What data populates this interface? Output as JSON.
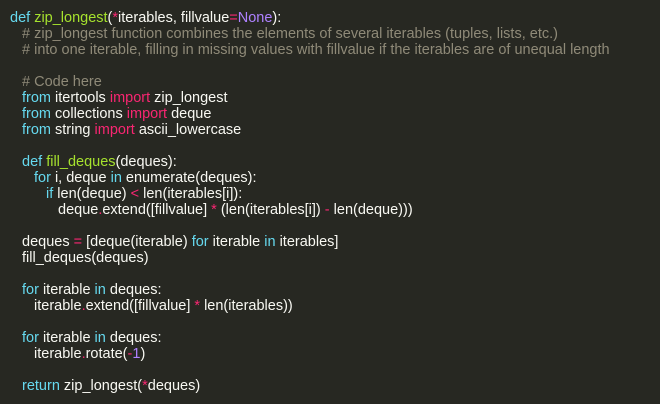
{
  "theme": {
    "background": "#272822",
    "text": "#f8f8f2",
    "keyword": "#66d9ef",
    "import_keyword": "#f92672",
    "operator": "#f92672",
    "function": "#a6e22e",
    "constant": "#ae81ff",
    "comment": "#8f8a78"
  },
  "code": {
    "lines": [
      {
        "tokens": [
          {
            "type": "keyword",
            "text": "def "
          },
          {
            "type": "function",
            "text": "zip_longest"
          },
          {
            "type": "text",
            "text": "("
          },
          {
            "type": "operator",
            "text": "*"
          },
          {
            "type": "text",
            "text": "iterables, fillvalue"
          },
          {
            "type": "operator",
            "text": "="
          },
          {
            "type": "constant",
            "text": "None"
          },
          {
            "type": "text",
            "text": "):"
          }
        ]
      },
      {
        "tokens": [
          {
            "type": "comment",
            "text": "# zip_longest function combines the elements of several iterables (tuples, lists, etc.)"
          }
        ]
      },
      {
        "tokens": [
          {
            "type": "comment",
            "text": "# into one iterable, filling in missing values with fillvalue if the iterables are of unequal length"
          }
        ]
      },
      {
        "tokens": []
      },
      {
        "tokens": [
          {
            "type": "comment",
            "text": "# Code here"
          }
        ]
      },
      {
        "tokens": [
          {
            "type": "keyword",
            "text": "from "
          },
          {
            "type": "text",
            "text": "itertools "
          },
          {
            "type": "import",
            "text": "import "
          },
          {
            "type": "text",
            "text": "zip_longest"
          }
        ]
      },
      {
        "tokens": [
          {
            "type": "keyword",
            "text": "from "
          },
          {
            "type": "text",
            "text": "collections "
          },
          {
            "type": "import",
            "text": "import "
          },
          {
            "type": "text",
            "text": "deque"
          }
        ]
      },
      {
        "tokens": [
          {
            "type": "keyword",
            "text": "from "
          },
          {
            "type": "text",
            "text": "string "
          },
          {
            "type": "import",
            "text": "import "
          },
          {
            "type": "text",
            "text": "ascii_lowercase"
          }
        ]
      },
      {
        "tokens": []
      },
      {
        "tokens": [
          {
            "type": "keyword",
            "text": "def "
          },
          {
            "type": "function",
            "text": "fill_deques"
          },
          {
            "type": "text",
            "text": "(deques):"
          }
        ]
      },
      {
        "tokens": [
          {
            "type": "keyword",
            "text": "for "
          },
          {
            "type": "text",
            "text": "i, deque "
          },
          {
            "type": "keyword",
            "text": "in "
          },
          {
            "type": "text",
            "text": "enumerate(deques):"
          }
        ]
      },
      {
        "tokens": [
          {
            "type": "keyword",
            "text": "if "
          },
          {
            "type": "text",
            "text": "len(deque) "
          },
          {
            "type": "operator",
            "text": "< "
          },
          {
            "type": "text",
            "text": "len(iterables[i]):"
          }
        ]
      },
      {
        "tokens": [
          {
            "type": "text",
            "text": "deque"
          },
          {
            "type": "operator",
            "text": "."
          },
          {
            "type": "text",
            "text": "extend([fillvalue] "
          },
          {
            "type": "operator",
            "text": "* "
          },
          {
            "type": "text",
            "text": "(len(iterables[i]) "
          },
          {
            "type": "operator",
            "text": "- "
          },
          {
            "type": "text",
            "text": "len(deque)))"
          }
        ]
      },
      {
        "tokens": []
      },
      {
        "tokens": [
          {
            "type": "text",
            "text": "deques "
          },
          {
            "type": "operator",
            "text": "= "
          },
          {
            "type": "text",
            "text": "[deque(iterable) "
          },
          {
            "type": "keyword",
            "text": "for "
          },
          {
            "type": "text",
            "text": "iterable "
          },
          {
            "type": "keyword",
            "text": "in "
          },
          {
            "type": "text",
            "text": "iterables]"
          }
        ]
      },
      {
        "tokens": [
          {
            "type": "text",
            "text": "fill_deques(deques)"
          }
        ]
      },
      {
        "tokens": []
      },
      {
        "tokens": [
          {
            "type": "keyword",
            "text": "for "
          },
          {
            "type": "text",
            "text": "iterable "
          },
          {
            "type": "keyword",
            "text": "in "
          },
          {
            "type": "text",
            "text": "deques:"
          }
        ]
      },
      {
        "tokens": [
          {
            "type": "text",
            "text": "iterable"
          },
          {
            "type": "operator",
            "text": "."
          },
          {
            "type": "text",
            "text": "extend([fillvalue] "
          },
          {
            "type": "operator",
            "text": "* "
          },
          {
            "type": "text",
            "text": "len(iterables))"
          }
        ]
      },
      {
        "tokens": []
      },
      {
        "tokens": [
          {
            "type": "keyword",
            "text": "for "
          },
          {
            "type": "text",
            "text": "iterable "
          },
          {
            "type": "keyword",
            "text": "in "
          },
          {
            "type": "text",
            "text": "deques:"
          }
        ]
      },
      {
        "tokens": [
          {
            "type": "text",
            "text": "iterable"
          },
          {
            "type": "operator",
            "text": "."
          },
          {
            "type": "text",
            "text": "rotate("
          },
          {
            "type": "operator",
            "text": "-"
          },
          {
            "type": "number",
            "text": "1"
          },
          {
            "type": "text",
            "text": ")"
          }
        ]
      },
      {
        "tokens": []
      },
      {
        "tokens": [
          {
            "type": "keyword",
            "text": "return "
          },
          {
            "type": "text",
            "text": "zip_longest("
          },
          {
            "type": "operator",
            "text": "*"
          },
          {
            "type": "text",
            "text": "deques)"
          }
        ]
      }
    ]
  }
}
